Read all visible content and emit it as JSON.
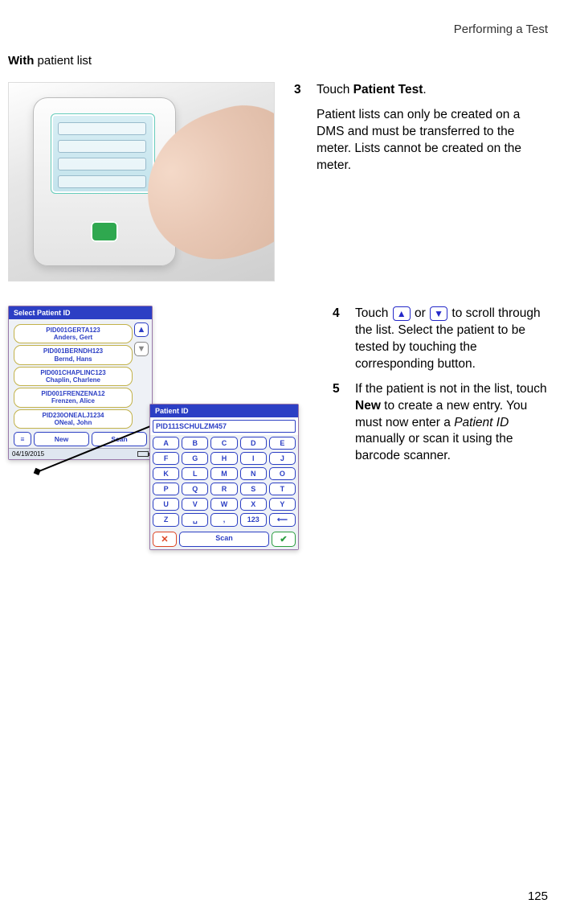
{
  "header": {
    "section": "Performing a Test"
  },
  "subhead": {
    "bold": "With",
    "rest": " patient list"
  },
  "step3": {
    "num": "3",
    "line_pre": "Touch ",
    "line_bold": "Patient Test",
    "line_post": ".",
    "para": "Patient lists can only be created on a DMS and must be transferred to the meter. Lists cannot be created on the meter."
  },
  "step4": {
    "num": "4",
    "pre": "Touch ",
    "mid": " or ",
    "post": " to scroll through the list. Select the patient to be tested by touching the corresponding button."
  },
  "step5": {
    "num": "5",
    "a": "If the patient is not in the list, touch ",
    "bold": "New",
    "b": " to create a new entry. You must now enter a ",
    "ital": "Patient ID",
    "c": " manually or scan it using the barcode scanner."
  },
  "win1": {
    "title": "Select Patient ID",
    "items": [
      {
        "id": "PID001GERTA123",
        "name": "Anders, Gert"
      },
      {
        "id": "PID001BERNDH123",
        "name": "Bernd, Hans"
      },
      {
        "id": "PID001CHAPLINC123",
        "name": "Chaplin, Charlene"
      },
      {
        "id": "PID001FRENZENA12",
        "name": "Frenzen, Alice"
      },
      {
        "id": "PID230ONEALJ1234",
        "name": "ONeal, John"
      }
    ],
    "new_label": "New",
    "scan_label": "Scan",
    "date": "04/19/2015"
  },
  "win2": {
    "title": "Patient ID",
    "input": "PID111SCHULZM457",
    "rows": [
      [
        "A",
        "B",
        "C",
        "D",
        "E"
      ],
      [
        "F",
        "G",
        "H",
        "I",
        "J"
      ],
      [
        "K",
        "L",
        "M",
        "N",
        "O"
      ],
      [
        "P",
        "Q",
        "R",
        "S",
        "T"
      ],
      [
        "U",
        "V",
        "W",
        "X",
        "Y"
      ]
    ],
    "last_row": {
      "z": "Z",
      "comma": ",",
      "num": "123"
    },
    "scan_label": "Scan"
  },
  "page": {
    "number": "125"
  }
}
